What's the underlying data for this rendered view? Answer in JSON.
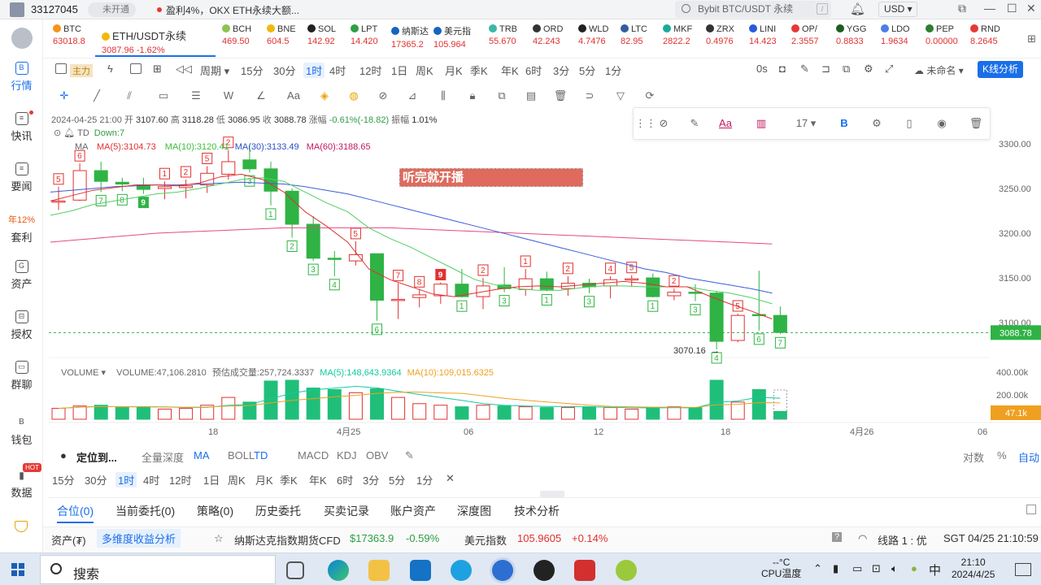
{
  "topbar": {
    "uid": "33127045",
    "badge": "未开通",
    "news": "盈利4%，OKX ETH永续大额...",
    "search_placeholder": "Bybit BTC/USDT 永续",
    "search_shortcut": "/",
    "currency": "USD"
  },
  "sidebar": {
    "items": [
      {
        "label": "行情",
        "icon": "B"
      },
      {
        "label": "快讯",
        "icon": "≡"
      },
      {
        "label": "要闻",
        "icon": "≡"
      },
      {
        "label": "套利",
        "icon": "年12%"
      },
      {
        "label": "资产",
        "icon": "G"
      },
      {
        "label": "授权",
        "icon": "⊟"
      },
      {
        "label": "群聊",
        "icon": "▭"
      },
      {
        "label": "钱包",
        "icon": "B"
      },
      {
        "label": "数据",
        "icon": "▮",
        "badge": "HOT"
      }
    ]
  },
  "tickers": [
    {
      "sym": "BTC",
      "price": "63018.8",
      "dir": "down"
    },
    {
      "sym": "ETH/USDT永续",
      "price": "3087.96 -1.62%",
      "dir": "down",
      "active": true
    },
    {
      "sym": "BCH",
      "price": "469.50",
      "dir": "down"
    },
    {
      "sym": "BNE",
      "price": "604.5",
      "dir": "down"
    },
    {
      "sym": "SOL",
      "price": "142.92",
      "dir": "down"
    },
    {
      "sym": "LPT",
      "price": "14.420",
      "dir": "down"
    },
    {
      "sym": "纳斯达",
      "price": "17365.2",
      "dir": "down"
    },
    {
      "sym": "美元指",
      "price": "105.964",
      "dir": "down"
    },
    {
      "sym": "TRB",
      "price": "55.670",
      "dir": "down"
    },
    {
      "sym": "ORD",
      "price": "42.243",
      "dir": "down"
    },
    {
      "sym": "WLD",
      "price": "4.7476",
      "dir": "down"
    },
    {
      "sym": "LTC",
      "price": "82.95",
      "dir": "down"
    },
    {
      "sym": "MKF",
      "price": "2822.2",
      "dir": "down"
    },
    {
      "sym": "ZRX",
      "price": "0.4976",
      "dir": "down"
    },
    {
      "sym": "LINI",
      "price": "14.423",
      "dir": "down"
    },
    {
      "sym": "OP/",
      "price": "2.3557",
      "dir": "down"
    },
    {
      "sym": "YGG",
      "price": "0.8833",
      "dir": "down"
    },
    {
      "sym": "LDO",
      "price": "1.9634",
      "dir": "down"
    },
    {
      "sym": "PEP",
      "price": "0.00000",
      "dir": "down"
    },
    {
      "sym": "RND",
      "price": "8.2645",
      "dir": "down"
    }
  ],
  "toolbar": {
    "zhuli": "主力",
    "period": "周期",
    "intervals": [
      "15分",
      "30分",
      "1时",
      "4时",
      "12时",
      "1日",
      "周K",
      "月K",
      "季K",
      "年K",
      "6时",
      "3分",
      "5分",
      "1分"
    ],
    "active_interval": "1时",
    "zero": "0s",
    "unnamed": "未命名",
    "kline_btn": "K线分析"
  },
  "floatbar": {
    "font_size": "17",
    "bold": "B",
    "text_tool": "Aa"
  },
  "ohlc": {
    "date": "2024-04-25 21:00",
    "open_label": "开",
    "open": "3107.60",
    "high_label": "高",
    "high": "3118.28",
    "low_label": "低",
    "low": "3086.95",
    "close_label": "收",
    "close": "3088.78",
    "change_label": "涨幅",
    "change": "-0.61%(-18.82)",
    "amp_label": "振幅",
    "amp": "1.01%"
  },
  "td": {
    "label": "TD",
    "down": "Down:7"
  },
  "ma": {
    "label": "MA",
    "ma5": "MA(5):3104.73",
    "ma10": "MA(10):3120.41",
    "ma30": "MA(30):3133.49",
    "ma60": "MA(60):3188.65"
  },
  "banner": "听完就开播",
  "volume": {
    "label": "VOLUME",
    "value": "VOLUME:47,106.2810",
    "estimate": "预估成交量:257,724.3337",
    "ma5": "MA(5):148,643.9364",
    "ma10": "MA(10):109,015.6325",
    "axis": [
      "400.00k",
      "200.00k"
    ],
    "current": "47.1k"
  },
  "chart_data": {
    "type": "candlestick",
    "interval": "1h",
    "price_axis": [
      "3300.00",
      "3250.00",
      "3200.00",
      "3150.00",
      "3100.00"
    ],
    "current_price": "3088.78",
    "low_marker": "3070.16",
    "time_axis": [
      "18",
      "4月25",
      "06",
      "12",
      "18",
      "4月26",
      "06"
    ],
    "candles": [
      {
        "o": 3236,
        "h": 3252,
        "l": 3226,
        "c": 3236,
        "td": "5"
      },
      {
        "o": 3237,
        "h": 3278,
        "l": 3236,
        "c": 3270,
        "td": "6"
      },
      {
        "o": 3270,
        "h": 3280,
        "l": 3246,
        "c": 3258,
        "td": "7"
      },
      {
        "o": 3257,
        "h": 3262,
        "l": 3247,
        "c": 3255,
        "td": "8"
      },
      {
        "o": 3254,
        "h": 3262,
        "l": 3244,
        "c": 3249,
        "td": "9"
      },
      {
        "o": 3250,
        "h": 3258,
        "l": 3238,
        "c": 3252,
        "td": "1"
      },
      {
        "o": 3251,
        "h": 3260,
        "l": 3239,
        "c": 3253,
        "td": "2"
      },
      {
        "o": 3254,
        "h": 3275,
        "l": 3245,
        "c": 3267,
        "td": "5"
      },
      {
        "o": 3266,
        "h": 3293,
        "l": 3260,
        "c": 3280,
        "td": "2"
      },
      {
        "o": 3282,
        "h": 3299,
        "l": 3268,
        "c": 3272,
        "td": "3"
      },
      {
        "o": 3272,
        "h": 3280,
        "l": 3231,
        "c": 3247,
        "td": "1"
      },
      {
        "o": 3247,
        "h": 3250,
        "l": 3195,
        "c": 3210,
        "td": "2"
      },
      {
        "o": 3210,
        "h": 3219,
        "l": 3169,
        "c": 3172,
        "td": "3"
      },
      {
        "o": 3172,
        "h": 3180,
        "l": 3152,
        "c": 3171,
        "td": "4"
      },
      {
        "o": 3169,
        "h": 3191,
        "l": 3164,
        "c": 3176,
        "td": "5"
      },
      {
        "o": 3177,
        "h": 3177,
        "l": 3102,
        "c": 3125,
        "td": "6"
      },
      {
        "o": 3125,
        "h": 3144,
        "l": 3104,
        "c": 3126,
        "td": "7"
      },
      {
        "o": 3128,
        "h": 3137,
        "l": 3117,
        "c": 3131,
        "td": "8"
      },
      {
        "o": 3130,
        "h": 3145,
        "l": 3121,
        "c": 3143,
        "td": "9"
      },
      {
        "o": 3143,
        "h": 3160,
        "l": 3128,
        "c": 3129,
        "td": "1"
      },
      {
        "o": 3129,
        "h": 3150,
        "l": 3115,
        "c": 3141,
        "td": "2"
      },
      {
        "o": 3142,
        "h": 3162,
        "l": 3134,
        "c": 3138,
        "td": "3"
      },
      {
        "o": 3137,
        "h": 3160,
        "l": 3130,
        "c": 3149,
        "td": "1"
      },
      {
        "o": 3149,
        "h": 3157,
        "l": 3135,
        "c": 3137,
        "td": "1"
      },
      {
        "o": 3138,
        "h": 3152,
        "l": 3130,
        "c": 3144,
        "td": "2"
      },
      {
        "o": 3144,
        "h": 3149,
        "l": 3133,
        "c": 3140,
        "td": "3"
      },
      {
        "o": 3141,
        "h": 3152,
        "l": 3127,
        "c": 3148,
        "td": "4"
      },
      {
        "o": 3148,
        "h": 3153,
        "l": 3140,
        "c": 3149,
        "td": "5"
      },
      {
        "o": 3150,
        "h": 3155,
        "l": 3128,
        "c": 3129,
        "td": "1"
      },
      {
        "o": 3130,
        "h": 3138,
        "l": 3125,
        "c": 3134,
        "td": "2"
      },
      {
        "o": 3134,
        "h": 3143,
        "l": 3124,
        "c": 3133,
        "td": "3"
      },
      {
        "o": 3133,
        "h": 3135,
        "l": 3070,
        "c": 3079,
        "td": "4"
      },
      {
        "o": 3080,
        "h": 3110,
        "l": 3078,
        "c": 3108,
        "td": "5"
      },
      {
        "o": 3109,
        "h": 3158,
        "l": 3091,
        "c": 3108,
        "td": "6"
      },
      {
        "o": 3108,
        "h": 3118,
        "l": 3087,
        "c": 3089,
        "td": "7"
      }
    ]
  },
  "indtabs": {
    "locate": "定位到...",
    "items": [
      "全量深度",
      "MA",
      "BOLL",
      "TD",
      "MACD",
      "KDJ",
      "OBV"
    ],
    "right": [
      "对数",
      "%",
      "自动"
    ]
  },
  "intervals2": [
    "15分",
    "30分",
    "1时",
    "4时",
    "12时",
    "1日",
    "周K",
    "月K",
    "季K",
    "年K",
    "6时",
    "3分",
    "5分",
    "1分"
  ],
  "bottomtabs": [
    "合位(0)",
    "当前委托(0)",
    "策略(0)",
    "历史委托",
    "买卖记录",
    "账户资产",
    "深度图",
    "技术分析"
  ],
  "status": {
    "asset": "资产(₮)",
    "analysis": "多维度收益分析",
    "nasdaq_label": "纳斯达克指数期货CFD",
    "nasdaq_price": "$17363.9",
    "nasdaq_change": "-0.59%",
    "usd_label": "美元指数",
    "usd_price": "105.9605",
    "usd_change": "+0.14%",
    "line": "线路 1 : 优",
    "time": "SGT 04/25 21:10:59"
  },
  "taskbar": {
    "search": "搜索",
    "temp": "--°C",
    "temp_label": "CPU温度",
    "ime": "中",
    "clock_time": "21:10",
    "clock_date": "2024/4/25"
  },
  "colors": {
    "up": "#e03131",
    "down": "#2fb344",
    "accent": "#1a6fe8"
  }
}
